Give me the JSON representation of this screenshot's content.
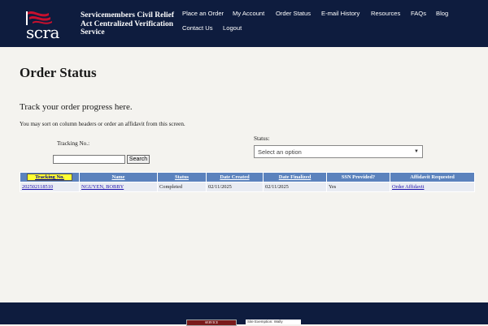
{
  "header": {
    "logo_text": "scra",
    "site_title": "Servicemembers Civil Relief Act Centralized Verification Service",
    "nav": [
      {
        "label": "Place an Order"
      },
      {
        "label": "My Account"
      },
      {
        "label": "Order Status"
      },
      {
        "label": "E-mail History"
      },
      {
        "label": "Resources"
      },
      {
        "label": "FAQs"
      },
      {
        "label": "Blog"
      },
      {
        "label": "Contact Us"
      },
      {
        "label": "Logout"
      }
    ]
  },
  "main": {
    "title": "Order Status",
    "subtitle": "Track your order progress here.",
    "hint": "You may sort on column headers or order an affidavit from this screen.",
    "tracking_label": "Tracking No.:",
    "tracking_value": "",
    "search_label": "Search",
    "status_label": "Status:",
    "status_placeholder": "Select an option"
  },
  "table": {
    "headers": [
      "Tracking No.",
      "Name",
      "Status",
      "Date Created",
      "Date Finalized",
      "SSN Provided?",
      "Affidavit Requested"
    ],
    "rows": [
      {
        "tracking": "202502118510",
        "name": "NGUYEN, BOBBY",
        "status": "Completed",
        "created": "02/11/2025",
        "finalized": "02/11/2025",
        "ssn": "Yes",
        "affidavit": "Order Affidavit"
      }
    ]
  },
  "footer": {
    "badge_left": "SERVICE",
    "badge_right": "Site Exemption: Wally"
  },
  "colors": {
    "header_bg": "#0e1c3e",
    "table_header": "#5b82bd",
    "sorted_header": "#ffff33",
    "row_bg": "#e9ecf3"
  }
}
